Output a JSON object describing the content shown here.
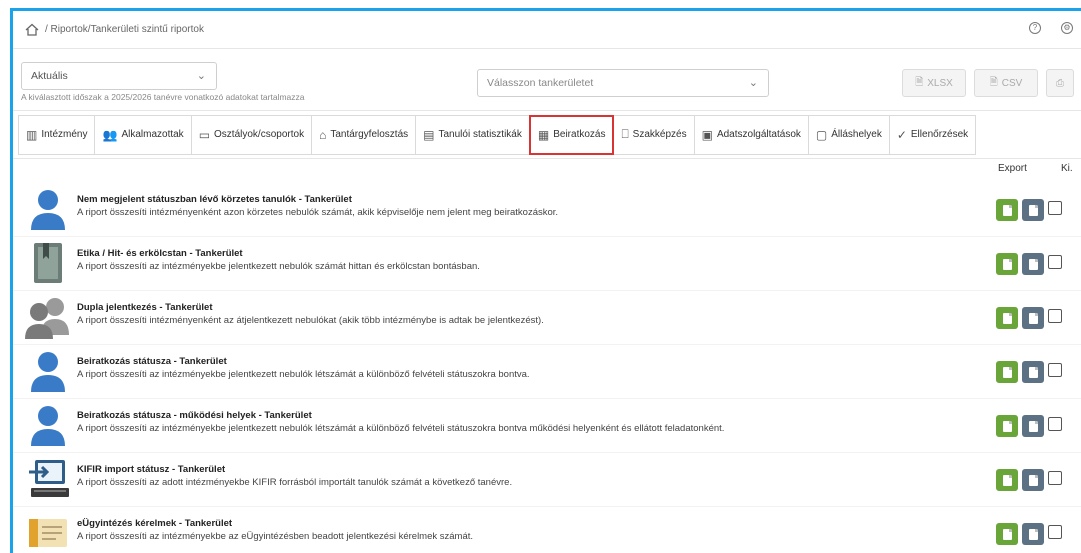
{
  "breadcrumb": {
    "text": "/ Riportok/Tankerületi szintű riportok"
  },
  "header_icons": [
    "help-icon",
    "settings-icon"
  ],
  "filters": {
    "period_value": "Aktuális",
    "hint": "A kiválasztott időszak a 2025/2026 tanévre vonatkozó adatokat tartalmazza",
    "district_placeholder": "Válasszon tankerületet",
    "xlsx_label": "XLSX",
    "csv_label": "CSV"
  },
  "tabs": [
    {
      "label": "Intézmény",
      "icon": "building-icon"
    },
    {
      "label": "Alkalmazottak",
      "icon": "users-icon"
    },
    {
      "label": "Osztályok/csoportok",
      "icon": "class-icon"
    },
    {
      "label": "Tantárgyfelosztás",
      "icon": "subject-icon"
    },
    {
      "label": "Tanulói statisztikák",
      "icon": "stats-icon"
    },
    {
      "label": "Beiratkozás",
      "icon": "enroll-icon",
      "active": true
    },
    {
      "label": "Szakképzés",
      "icon": "bookmark-icon"
    },
    {
      "label": "Adatszolgáltatások",
      "icon": "data-icon"
    },
    {
      "label": "Álláshelyek",
      "icon": "position-icon"
    },
    {
      "label": "Ellenőrzések",
      "icon": "check-icon"
    }
  ],
  "columns": {
    "export": "Export",
    "ki": "Ki."
  },
  "reports": [
    {
      "title": "Nem megjelent státuszban lévő körzetes tanulók - Tankerület",
      "desc": "A riport összesíti intézményenként azon körzetes nebulók számát, akik képviselője nem jelent meg beiratkozáskor.",
      "icon": "person-icon"
    },
    {
      "title": "Etika / Hit- és erkölcstan - Tankerület",
      "desc": "A riport összesíti az intézményekbe jelentkezett nebulók számát hittan és erkölcstan bontásban.",
      "icon": "book-icon"
    },
    {
      "title": "Dupla jelentkezés - Tankerület",
      "desc": "A riport összesíti intézményenként az átjelentkezett nebulókat (akik több intézménybe is adtak be jelentkezést).",
      "icon": "group-icon"
    },
    {
      "title": "Beiratkozás státusza - Tankerület",
      "desc": "A riport összesíti az intézményekbe jelentkezett nebulók létszámát a különböző felvételi státuszokra bontva.",
      "icon": "person-icon"
    },
    {
      "title": "Beiratkozás státusza - működési helyek - Tankerület",
      "desc": "A riport összesíti az intézményekbe jelentkezett nebulók létszámát a különböző felvételi státuszokra bontva működési helyenként és ellátott feladatonként.",
      "icon": "person-icon"
    },
    {
      "title": "KIFIR import státusz - Tankerület",
      "desc": "A riport összesíti az adott intézményekbe KIFIR forrásból importált tanulók számát a következő tanévre.",
      "icon": "computer-import-icon"
    },
    {
      "title": "eÜgyintézés kérelmek - Tankerület",
      "desc": "A riport összesíti az intézményekbe az eÜgyintézésben beadott jelentkezési kérelmek számát.",
      "icon": "id-card-icon"
    }
  ]
}
